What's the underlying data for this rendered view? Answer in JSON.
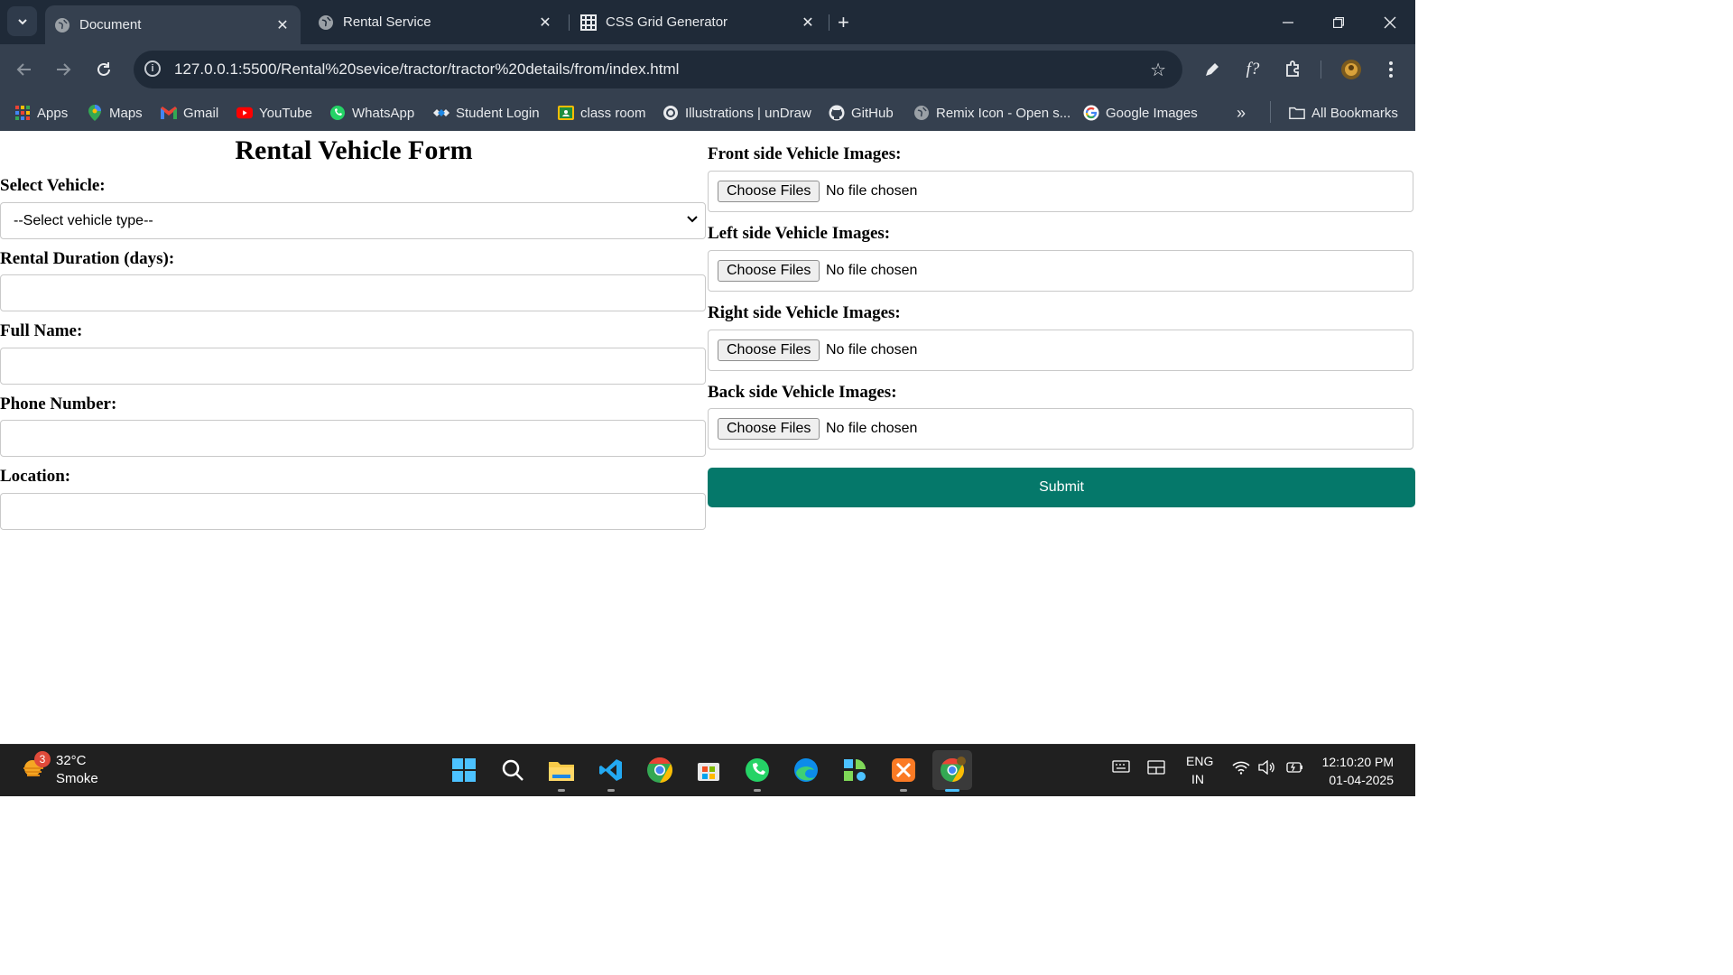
{
  "browser": {
    "tabs": [
      {
        "title": "Document",
        "active": true
      },
      {
        "title": "Rental Service",
        "active": false
      },
      {
        "title": "CSS Grid Generator",
        "active": false
      }
    ],
    "url": "127.0.0.1:5500/Rental%20sevice/tractor/tractor%20details/from/index.html",
    "bookmarks": [
      {
        "label": "Apps",
        "icon": "apps-grid-icon"
      },
      {
        "label": "Maps",
        "icon": "maps-icon"
      },
      {
        "label": "Gmail",
        "icon": "gmail-icon"
      },
      {
        "label": "YouTube",
        "icon": "youtube-icon"
      },
      {
        "label": "WhatsApp",
        "icon": "whatsapp-icon"
      },
      {
        "label": "Student Login",
        "icon": "student-login-icon"
      },
      {
        "label": "class room",
        "icon": "classroom-icon"
      },
      {
        "label": "Illustrations | unDraw",
        "icon": "undraw-icon"
      },
      {
        "label": "GitHub",
        "icon": "github-icon"
      },
      {
        "label": "Remix Icon - Open s...",
        "icon": "globe-icon"
      },
      {
        "label": "Google Images",
        "icon": "google-icon"
      }
    ],
    "all_bookmarks": "All Bookmarks"
  },
  "form": {
    "title": "Rental Vehicle Form",
    "select_vehicle": {
      "label": "Select Vehicle:",
      "value": "--Select vehicle type--"
    },
    "duration": {
      "label": "Rental Duration (days):",
      "value": ""
    },
    "full_name": {
      "label": "Full Name:",
      "value": ""
    },
    "phone": {
      "label": "Phone Number:",
      "value": ""
    },
    "location": {
      "label": "Location:",
      "value": ""
    },
    "front_images": {
      "label": "Front side Vehicle Images:",
      "button": "Choose Files",
      "status": "No file chosen"
    },
    "left_images": {
      "label": "Left side Vehicle Images:",
      "button": "Choose Files",
      "status": "No file chosen"
    },
    "right_images": {
      "label": "Right side Vehicle Images:",
      "button": "Choose Files",
      "status": "No file chosen"
    },
    "back_images": {
      "label": "Back side Vehicle Images:",
      "button": "Choose Files",
      "status": "No file chosen"
    },
    "submit": "Submit",
    "accent_color": "#05786a"
  },
  "taskbar": {
    "weather": {
      "badge": "3",
      "temp": "32°C",
      "desc": "Smoke"
    },
    "apps": [
      "start-icon",
      "search-icon",
      "file-explorer-icon",
      "vscode-icon",
      "chrome-icon",
      "ms-store-icon",
      "whatsapp-icon",
      "edge-icon",
      "app-icon",
      "xampp-icon",
      "chrome-profile-icon"
    ],
    "lang": {
      "line1": "ENG",
      "line2": "IN"
    },
    "time": "12:10:20 PM",
    "date": "01-04-2025"
  }
}
